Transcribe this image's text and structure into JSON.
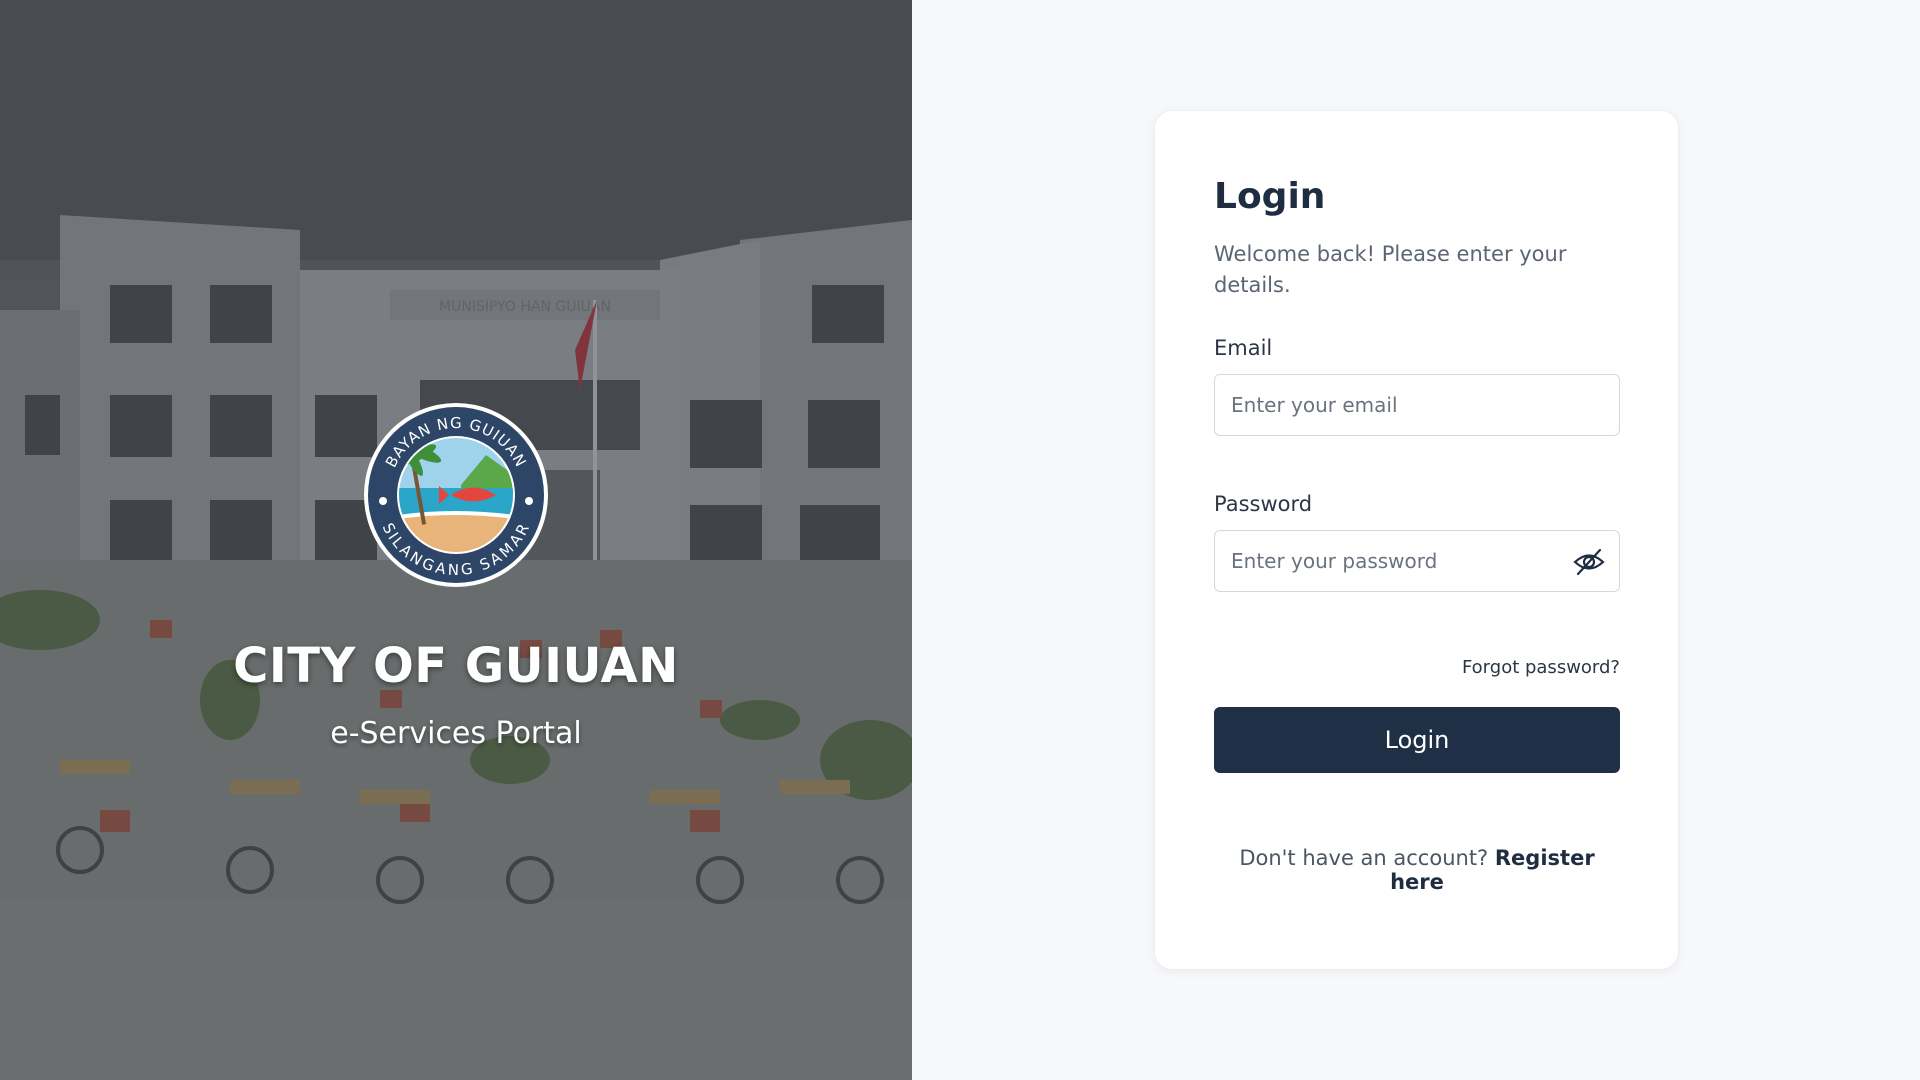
{
  "hero": {
    "building_sign": "MUNISIPYO HAN GUIUAN",
    "seal": {
      "top_text": "BAYAN NG GUIUAN",
      "bottom_text": "SILANGANG SAMAR",
      "icon": "guiuan-seal-icon"
    },
    "title": "CITY OF GUIUAN",
    "subtitle": "e-Services Portal"
  },
  "login": {
    "title": "Login",
    "description": "Welcome back! Please enter your details.",
    "email": {
      "label": "Email",
      "placeholder": "Enter your email",
      "value": ""
    },
    "password": {
      "label": "Password",
      "placeholder": "Enter your password",
      "value": "",
      "toggle_icon": "eye-off-icon"
    },
    "forgot_password": "Forgot password?",
    "submit_label": "Login",
    "register_prompt": "Don't have an account?",
    "register_link": "Register here"
  },
  "colors": {
    "primary": "#1f2f46",
    "page_background": "#f7f8fa",
    "card_background": "#ffffff",
    "text_dark": "#1f2d40",
    "text_muted": "#5b6574"
  }
}
